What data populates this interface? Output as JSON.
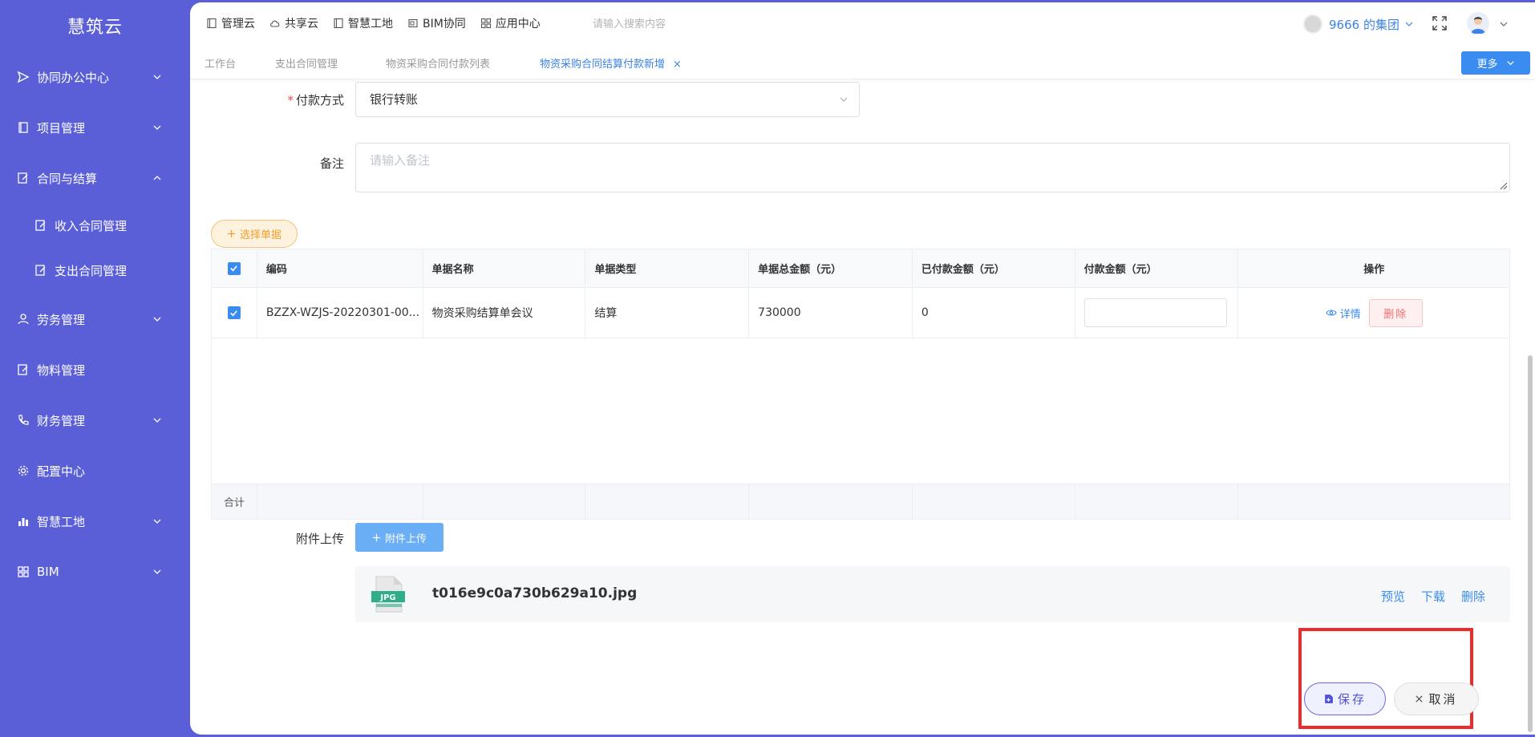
{
  "sidebar": {
    "brand": "慧筑云",
    "items": [
      {
        "label": "协同办公中心",
        "icon": "send-icon",
        "expanded": false
      },
      {
        "label": "项目管理",
        "icon": "book-icon",
        "expanded": false
      },
      {
        "label": "合同与结算",
        "icon": "edit-doc-icon",
        "expanded": true
      },
      {
        "label": "收入合同管理",
        "icon": "edit-doc-icon"
      },
      {
        "label": "支出合同管理",
        "icon": "edit-doc-icon"
      },
      {
        "label": "劳务管理",
        "icon": "user-icon",
        "expanded": false
      },
      {
        "label": "物料管理",
        "icon": "edit-doc-icon"
      },
      {
        "label": "财务管理",
        "icon": "phone-icon",
        "expanded": false
      },
      {
        "label": "配置中心",
        "icon": "gear-icon"
      },
      {
        "label": "智慧工地",
        "icon": "bar-chart-icon",
        "expanded": false
      },
      {
        "label": "BIM",
        "icon": "grid-icon",
        "expanded": false
      }
    ]
  },
  "topnav": {
    "items": [
      {
        "label": "管理云",
        "icon": "doc-icon"
      },
      {
        "label": "共享云",
        "icon": "cloud-icon"
      },
      {
        "label": "智慧工地",
        "icon": "doc-icon"
      },
      {
        "label": "BIM协同",
        "icon": "file-icon"
      },
      {
        "label": "应用中心",
        "icon": "grid-icon"
      }
    ],
    "search_placeholder": "请输入搜索内容",
    "org_name": "9666 的集团"
  },
  "tabs": {
    "items": [
      {
        "label": "工作台"
      },
      {
        "label": "支出合同管理"
      },
      {
        "label": "物资采购合同付款列表"
      },
      {
        "label": "物资采购合同结算付款新增",
        "active": true,
        "close": "×"
      }
    ],
    "more_label": "更多"
  },
  "form": {
    "payment_method_label": "付款方式",
    "required_mark": "*",
    "payment_method_value": "银行转账",
    "remark_label": "备注",
    "remark_placeholder": "请输入备注",
    "choose_doc_label": "选择单据",
    "attachment_label": "附件上传",
    "attach_button_label": "附件上传"
  },
  "table": {
    "headers": [
      "编码",
      "单据名称",
      "单据类型",
      "单据总金额（元）",
      "已付款金额（元）",
      "付款金额（元）",
      "操作"
    ],
    "rows": [
      {
        "code": "BZZX-WZJS-20220301-00...",
        "name": "物资采购结算单会议",
        "type": "结算",
        "total": "730000",
        "paid": "0",
        "payment": "",
        "detail_label": "详情",
        "delete_label": "删除"
      }
    ],
    "sum_label": "合计"
  },
  "attachment": {
    "file_name": "t016e9c0a730b629a10.jpg",
    "file_type": "JPG",
    "preview_label": "预览",
    "download_label": "下载",
    "delete_label": "删除"
  },
  "actions": {
    "save_label": "保存",
    "cancel_label": "取消"
  },
  "colors": {
    "sidebar_bg": "#5a5fd8",
    "accent": "#3b8cf0",
    "danger": "#f56c6c",
    "highlight": "#ee2b2b"
  }
}
